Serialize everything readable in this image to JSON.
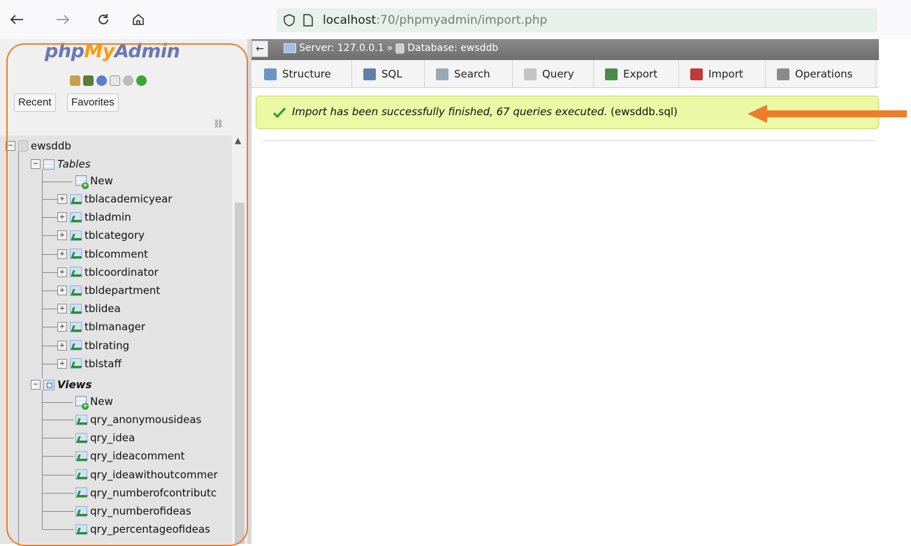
{
  "browser": {
    "url_host": "localhost",
    "url_rest": ":70/phpmyadmin/import.php",
    "back_icon": "back-arrow-icon",
    "forward_icon": "forward-arrow-icon",
    "reload_icon": "reload-icon",
    "home_icon": "home-icon"
  },
  "sidebar": {
    "logo_php": "php",
    "logo_my": "My",
    "logo_admin": "Admin",
    "recent_label": "Recent",
    "favorites_label": "Favorites",
    "tree": {
      "database": "ewsddb",
      "tables_label": "Tables",
      "tables_new": "New",
      "tables": [
        "tblacademicyear",
        "tbladmin",
        "tblcategory",
        "tblcomment",
        "tblcoordinator",
        "tbldepartment",
        "tblidea",
        "tblmanager",
        "tblrating",
        "tblstaff"
      ],
      "views_label": "Views",
      "views_new": "New",
      "views": [
        "qry_anonymousideas",
        "qry_idea",
        "qry_ideacomment",
        "qry_ideawithoutcommer",
        "qry_numberofcontributc",
        "qry_numberofideas",
        "qry_percentageofideas"
      ]
    }
  },
  "breadcrumb": {
    "server": "Server: 127.0.0.1",
    "separator": "»",
    "database": "Database: ewsddb"
  },
  "tabs": [
    "Structure",
    "SQL",
    "Search",
    "Query",
    "Export",
    "Import",
    "Operations"
  ],
  "message": {
    "italic": "Import has been successfully finished, 67 queries executed.",
    "file": "(ewsddb.sql)"
  },
  "colors": {
    "accent_orange": "#ee7d2a",
    "success_bg": "#ebf8a4"
  }
}
